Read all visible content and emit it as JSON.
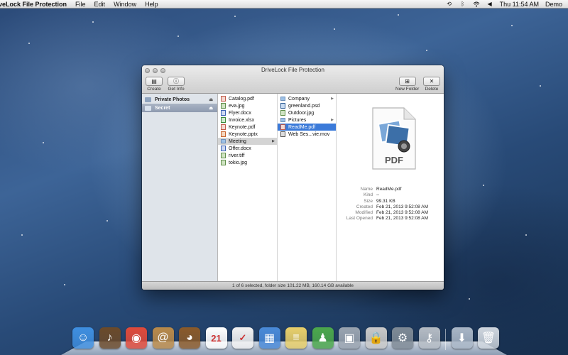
{
  "menubar": {
    "app_name": "veLock File Protection",
    "items": [
      "File",
      "Edit",
      "Window",
      "Help"
    ],
    "clock": "Thu 11:54 AM",
    "user": "Demo"
  },
  "window": {
    "title": "DriveLock File Protection",
    "toolbar": {
      "create": "Create",
      "get_info": "Get Info",
      "new_folder": "New Folder",
      "delete": "Delete"
    },
    "sidebar": [
      {
        "label": "Private Photos",
        "selected": false
      },
      {
        "label": "Secret",
        "selected": true
      }
    ],
    "column1": [
      {
        "name": "Catalog.pdf",
        "type": "pdf"
      },
      {
        "name": "eva.jpg",
        "type": "img"
      },
      {
        "name": "Flyer.docx",
        "type": "doc"
      },
      {
        "name": "Invoice.xlsx",
        "type": "xls"
      },
      {
        "name": "Keynote.pdf",
        "type": "pdf"
      },
      {
        "name": "Keynote.pptx",
        "type": "ppt"
      },
      {
        "name": "Meeting",
        "type": "folder",
        "selected": true
      },
      {
        "name": "Offer.docx",
        "type": "doc"
      },
      {
        "name": "river.tiff",
        "type": "img"
      },
      {
        "name": "tokio.jpg",
        "type": "img"
      }
    ],
    "column2": [
      {
        "name": "Company",
        "type": "folder"
      },
      {
        "name": "greenland.psd",
        "type": "psd"
      },
      {
        "name": "Outdoor.jpg",
        "type": "img"
      },
      {
        "name": "Pictures",
        "type": "folder"
      },
      {
        "name": "ReadMe.pdf",
        "type": "pdf",
        "selected": true
      },
      {
        "name": "Web Ses...vie.mov",
        "type": "mov"
      }
    ],
    "preview": {
      "icon_label": "PDF",
      "info": [
        {
          "key": "Name",
          "value": "ReadMe.pdf"
        },
        {
          "key": "Kind",
          "value": "--"
        },
        {
          "key": "Size",
          "value": "99.31 KB"
        },
        {
          "key": "Created",
          "value": "Feb 21, 2013 9:52:08 AM"
        },
        {
          "key": "Modified",
          "value": "Feb 21, 2013 9:52:08 AM"
        },
        {
          "key": "Last Opened",
          "value": "Feb 21, 2013 9:52:08 AM"
        }
      ]
    },
    "status": "1 of 6 selected, folder size 101.22 MB, 160.14 GB available"
  },
  "dock": [
    {
      "name": "finder-icon",
      "color": "#3f8fe0",
      "glyph": "☺"
    },
    {
      "name": "garageband-icon",
      "color": "#6b4a2a",
      "glyph": "♪"
    },
    {
      "name": "chrome-icon",
      "color": "#e04a3a",
      "glyph": "◉"
    },
    {
      "name": "address-book-icon",
      "color": "#b98a4a",
      "glyph": "@"
    },
    {
      "name": "owl-app-icon",
      "color": "#8a5a2a",
      "glyph": "◕"
    },
    {
      "name": "calendar-icon",
      "color": "#ffffff",
      "glyph": "21"
    },
    {
      "name": "reminders-icon",
      "color": "#f2f2f2",
      "glyph": "✓"
    },
    {
      "name": "stacks-app-icon",
      "color": "#4a8ad8",
      "glyph": "▦"
    },
    {
      "name": "notes-icon",
      "color": "#e8cf6a",
      "glyph": "≡"
    },
    {
      "name": "green-figure-app-icon",
      "color": "#4ca84c",
      "glyph": "♟"
    },
    {
      "name": "vault-icon",
      "color": "#9aa4b0",
      "glyph": "▣"
    },
    {
      "name": "drivelock-icon",
      "color": "#c9c9c9",
      "glyph": "🔒"
    },
    {
      "name": "system-preferences-icon",
      "color": "#7f8a96",
      "glyph": "⚙"
    },
    {
      "name": "keychain-icon",
      "color": "#b5bcc4",
      "glyph": "⚷"
    },
    {
      "name": "sep",
      "color": "",
      "glyph": ""
    },
    {
      "name": "downloads-stack-icon",
      "color": "#a9b6c6",
      "glyph": "⬇"
    },
    {
      "name": "trash-icon",
      "color": "#cfd6de",
      "glyph": "🗑"
    }
  ]
}
